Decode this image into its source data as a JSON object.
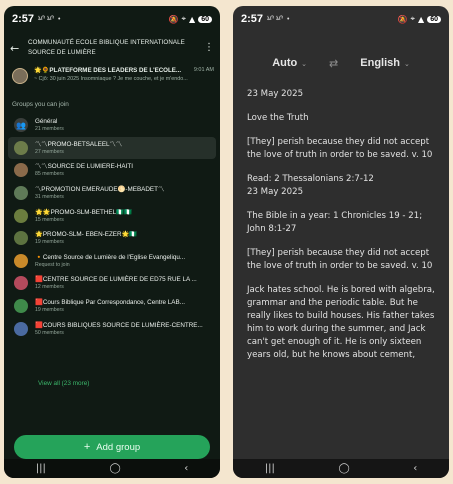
{
  "status_bar": {
    "time": "2:57",
    "battery": "60",
    "notif": "ኒቦ ኒቦ"
  },
  "left": {
    "community_title": "COMMUNAUTÉ ECOLE BIBLIQUE INTERNATIONALE SOURCE DE LUMIÈRE",
    "pinned": {
      "name": "🌟🌻PLATEFORME DES LEADERS DE L'ECOLE...",
      "time": "9:01 AM",
      "preview": "~ Cjõ: 30 juin 2025 Insomniaque ? Je me couche, et je m'endo..."
    },
    "section_title": "Groups you can join",
    "groups": [
      {
        "name": "Général",
        "count": "21 members",
        "color": "#3a3f3c",
        "icon": "group-icon"
      },
      {
        "name": "〽〽PROMO-BETSALEEL〽〽",
        "count": "27 members",
        "color": "#6d7c4a",
        "icon": "group-photo"
      },
      {
        "name": "〽〽SOURCE DE LUMIERE-HAITI",
        "count": "85 members",
        "color": "#8a6a4a",
        "icon": "group-photo"
      },
      {
        "name": "〽PROMOTION EMERAUDE🌕-MEBADET〽",
        "count": "31 members",
        "color": "#5f7a58",
        "icon": "group-photo"
      },
      {
        "name": "🌟🌟PROMO-SLM-BETHEL🇳🇬🇳🇬",
        "count": "15 members",
        "color": "#6b7d3e",
        "icon": "group-photo"
      },
      {
        "name": "🌟PROMO-SLM- EBEN-EZER🌟🇳🇬",
        "count": "19 members",
        "color": "#5d7340",
        "icon": "group-photo"
      },
      {
        "name": "🔸Centre Source de Lumière de l'Eglise Evangeliqu...",
        "count": "Request to join",
        "color": "#c98a2a",
        "icon": "group-photo"
      },
      {
        "name": "🟥CENTRE SOURCE DE LUMIÈRE DE ED75 RUE LA ...",
        "count": "12 members",
        "color": "#b44a5c",
        "icon": "group-photo"
      },
      {
        "name": "🟥Cours Biblique Par Correspondance, Centre LAB...",
        "count": "19 members",
        "color": "#3f8a4a",
        "icon": "group-photo"
      },
      {
        "name": "🟥COURS BIBLIQUES SOURCE DE LUMIÈRE-CENTRE...",
        "count": "50 members",
        "color": "#4a6aa0",
        "icon": "group-photo"
      }
    ],
    "view_all": "View all (23 more)",
    "add_group": "Add group"
  },
  "right": {
    "source_lang": "Auto",
    "target_lang": "English",
    "paragraphs": [
      "23 May 2025",
      "Love the Truth",
      "[They] perish because they did not accept the love of truth in order to be saved. v. 10",
      "Read: 2 Thessalonians 2:7-12\n23 May 2025",
      "The Bible in a year: 1 Chronicles 19 - 21; John 8:1-27",
      "[They] perish because they did not accept the love of truth in order to be saved. v. 10",
      "Jack hates school. He is bored with algebra, grammar and the periodic table. But he really likes to build houses. His father takes him to work during the summer, and Jack can't get enough of it. He is only sixteen years old, but he knows about cement,"
    ]
  },
  "colors": {
    "accent_green": "#25a35a",
    "link_green": "#3bb66a",
    "left_bg": "#101a14",
    "right_bg": "#2e2e2e"
  }
}
